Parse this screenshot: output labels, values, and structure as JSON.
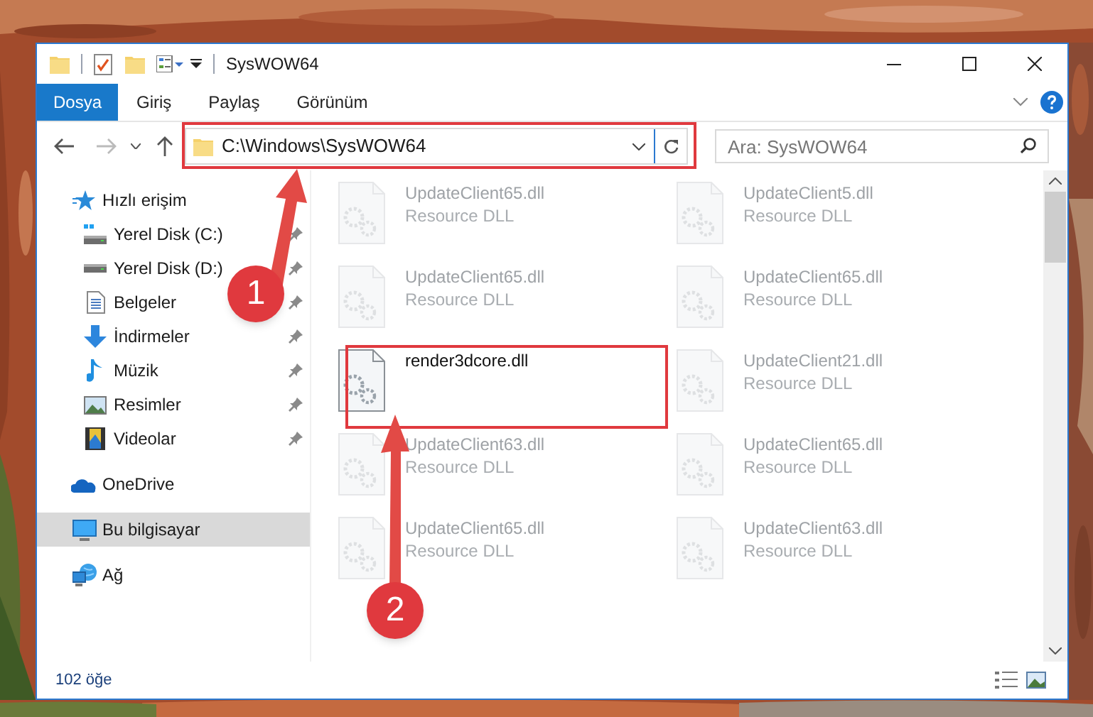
{
  "window": {
    "title": "SysWOW64"
  },
  "ribbon_tabs": [
    {
      "label": "Dosya",
      "kind": "file_menu"
    },
    {
      "label": "Giriş",
      "kind": "tab"
    },
    {
      "label": "Paylaş",
      "kind": "tab"
    },
    {
      "label": "Görünüm",
      "kind": "tab"
    }
  ],
  "address_bar": {
    "path": "C:\\Windows\\SysWOW64"
  },
  "search": {
    "placeholder": "Ara: SysWOW64"
  },
  "sidebar": {
    "items": [
      {
        "label": "Hızlı erişim",
        "selected": false,
        "children": [
          {
            "label": "Yerel Disk (C:)",
            "pinned": true,
            "selected": false
          },
          {
            "label": "Yerel Disk (D:)",
            "pinned": true,
            "selected": false
          },
          {
            "label": "Belgeler",
            "pinned": true,
            "selected": false
          },
          {
            "label": "İndirmeler",
            "pinned": true,
            "selected": false
          },
          {
            "label": "Müzik",
            "pinned": true,
            "selected": false
          },
          {
            "label": "Resimler",
            "pinned": true,
            "selected": false
          },
          {
            "label": "Videolar",
            "pinned": true,
            "selected": false
          }
        ]
      },
      {
        "label": "OneDrive",
        "selected": false
      },
      {
        "label": "Bu bilgisayar",
        "selected": true
      },
      {
        "label": "Ağ",
        "selected": false
      }
    ]
  },
  "files": [
    {
      "name": "UpdateClient65.dll",
      "type": "Resource DLL",
      "blurred": true
    },
    {
      "name": "UpdateClient5.dll",
      "type": "Resource DLL",
      "blurred": true
    },
    {
      "name": "UpdateClient65.dll",
      "type": "Resource DLL",
      "blurred": true
    },
    {
      "name": "UpdateClient65.dll",
      "type": "Resource DLL",
      "blurred": true
    },
    {
      "name": "render3dcore.dll",
      "blurred": false
    },
    {
      "name": "UpdateClient21.dll",
      "type": "Resource DLL",
      "blurred": true
    },
    {
      "name": "UpdateClient63.dll",
      "type": "Resource DLL",
      "blurred": true
    },
    {
      "name": "UpdateClient65.dll",
      "type": "Resource DLL",
      "blurred": true
    },
    {
      "name": "UpdateClient65.dll",
      "type": "Resource DLL",
      "blurred": true
    },
    {
      "name": "UpdateClient63.dll",
      "type": "Resource DLL",
      "blurred": true
    }
  ],
  "status_bar": {
    "item_count": "102 öğe"
  },
  "annotations": [
    {
      "number": "1"
    },
    {
      "number": "2"
    }
  ]
}
